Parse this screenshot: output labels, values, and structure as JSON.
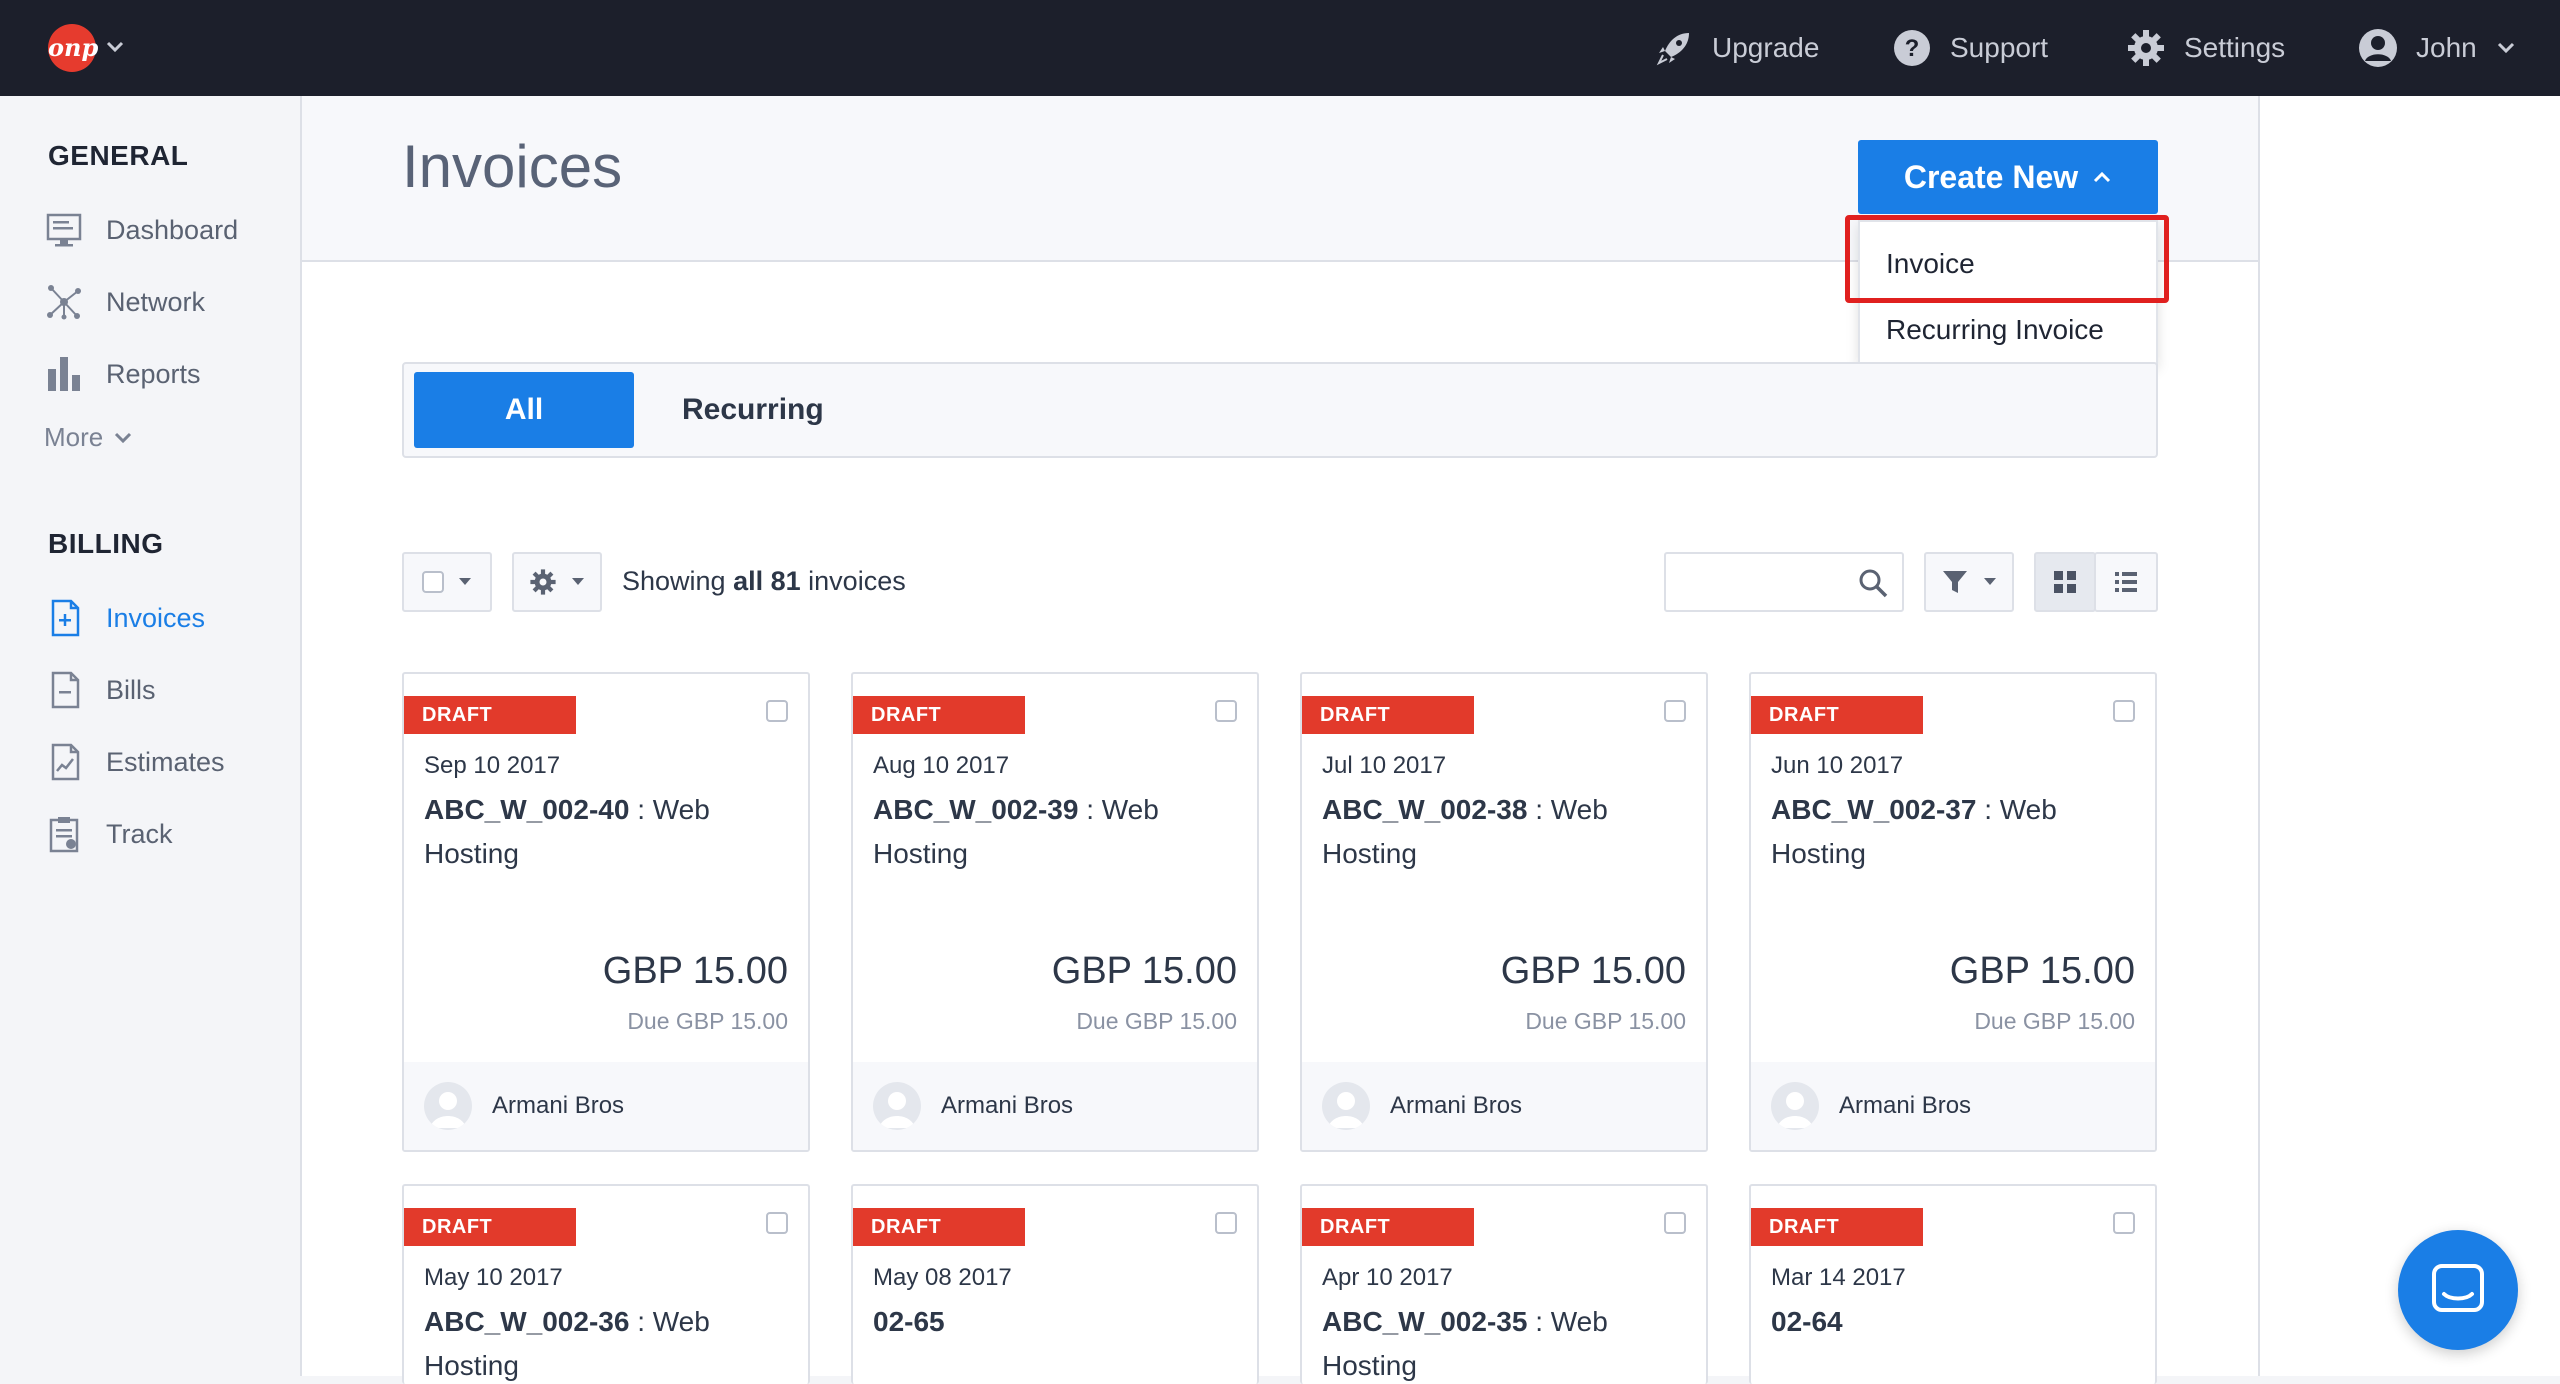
{
  "topbar": {
    "logo_text": "onp",
    "nav": [
      {
        "label": "Upgrade",
        "icon": "rocket-icon"
      },
      {
        "label": "Support",
        "icon": "question-icon"
      },
      {
        "label": "Settings",
        "icon": "gear-icon"
      },
      {
        "label": "John",
        "icon": "user-icon"
      }
    ]
  },
  "sidebar": {
    "general_heading": "GENERAL",
    "general_items": [
      {
        "label": "Dashboard",
        "icon": "dashboard-icon"
      },
      {
        "label": "Network",
        "icon": "network-icon"
      },
      {
        "label": "Reports",
        "icon": "bar-chart-icon"
      }
    ],
    "more_label": "More",
    "billing_heading": "BILLING",
    "billing_items": [
      {
        "label": "Invoices",
        "icon": "invoice-icon",
        "active": true
      },
      {
        "label": "Bills",
        "icon": "bill-icon"
      },
      {
        "label": "Estimates",
        "icon": "estimate-icon"
      },
      {
        "label": "Track",
        "icon": "clipboard-icon"
      }
    ]
  },
  "header": {
    "title": "Invoices",
    "create_new_label": "Create New",
    "dropdown_items": [
      "Invoice",
      "Recurring Invoice"
    ]
  },
  "tabs": {
    "all": "All",
    "recurring": "Recurring"
  },
  "toolbar": {
    "showing_prefix": "Showing",
    "showing_all": "all 81",
    "showing_suffix": "invoices",
    "search_placeholder": ""
  },
  "cards": [
    {
      "status": "DRAFT",
      "date": "Sep 10 2017",
      "number": "ABC_W_002-40",
      "desc": " : Web Hosting",
      "amount": "GBP 15.00",
      "due": "Due GBP 15.00",
      "client": "Armani Bros"
    },
    {
      "status": "DRAFT",
      "date": "Aug 10 2017",
      "number": "ABC_W_002-39",
      "desc": " : Web Hosting",
      "amount": "GBP 15.00",
      "due": "Due GBP 15.00",
      "client": "Armani Bros"
    },
    {
      "status": "DRAFT",
      "date": "Jul 10 2017",
      "number": "ABC_W_002-38",
      "desc": " : Web Hosting",
      "amount": "GBP 15.00",
      "due": "Due GBP 15.00",
      "client": "Armani Bros"
    },
    {
      "status": "DRAFT",
      "date": "Jun 10 2017",
      "number": "ABC_W_002-37",
      "desc": " : Web Hosting",
      "amount": "GBP 15.00",
      "due": "Due GBP 15.00",
      "client": "Armani Bros"
    },
    {
      "status": "DRAFT",
      "date": "May 10 2017",
      "number": "ABC_W_002-36",
      "desc": " : Web Hosting",
      "amount": "",
      "due": "",
      "client": ""
    },
    {
      "status": "DRAFT",
      "date": "May 08 2017",
      "number": "02-65",
      "desc": "",
      "amount": "",
      "due": "",
      "client": ""
    },
    {
      "status": "DRAFT",
      "date": "Apr 10 2017",
      "number": "ABC_W_002-35",
      "desc": " : Web Hosting",
      "amount": "",
      "due": "",
      "client": ""
    },
    {
      "status": "DRAFT",
      "date": "Mar 14 2017",
      "number": "02-64",
      "desc": "",
      "amount": "",
      "due": "",
      "client": ""
    }
  ],
  "colors": {
    "accent": "#1a7ee6",
    "draft": "#e23a2b",
    "highlight": "#e0201f",
    "topbar": "#1c1f2b"
  }
}
